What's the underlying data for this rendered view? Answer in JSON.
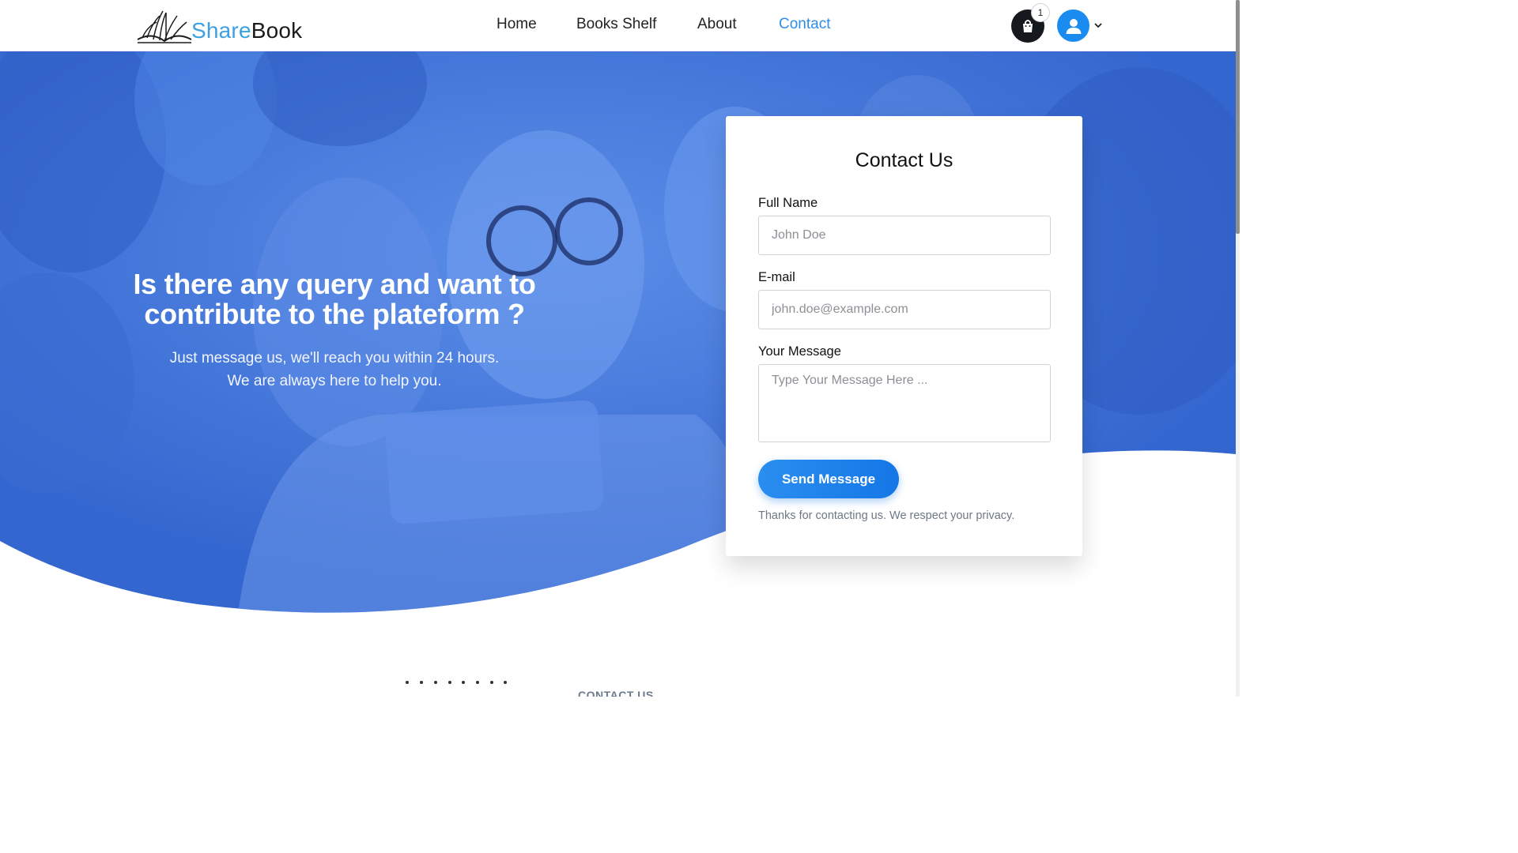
{
  "brand": {
    "share": "Share",
    "book": "Book"
  },
  "nav": {
    "links": [
      {
        "label": "Home",
        "active": false
      },
      {
        "label": "Books Shelf",
        "active": false
      },
      {
        "label": "About",
        "active": false
      },
      {
        "label": "Contact",
        "active": true
      }
    ],
    "cart_count": "1"
  },
  "hero": {
    "title": "Is there any query and want to contribute to the plateform ?",
    "subtitle_line1": "Just message us, we'll reach you within 24 hours.",
    "subtitle_line2": "We are always here to help you."
  },
  "contact_form": {
    "title": "Contact Us",
    "name_label": "Full Name",
    "name_placeholder": "John Doe",
    "email_label": "E-mail",
    "email_placeholder": "john.doe@example.com",
    "message_label": "Your Message",
    "message_placeholder": "Type Your Message Here ...",
    "submit_label": "Send Message",
    "note": "Thanks for contacting us. We respect your privacy."
  },
  "section": {
    "eyebrow": "CONTACT US"
  },
  "colors": {
    "accent": "#1a8cf0",
    "nav_active": "#2f8ee8",
    "hero_overlay": "#3f74dc",
    "cart_bg": "#15181d"
  },
  "icons": {
    "logo": "open-book-icon",
    "cart": "shopping-bag-icon",
    "avatar": "user-icon",
    "dropdown": "chevron-down-icon"
  }
}
